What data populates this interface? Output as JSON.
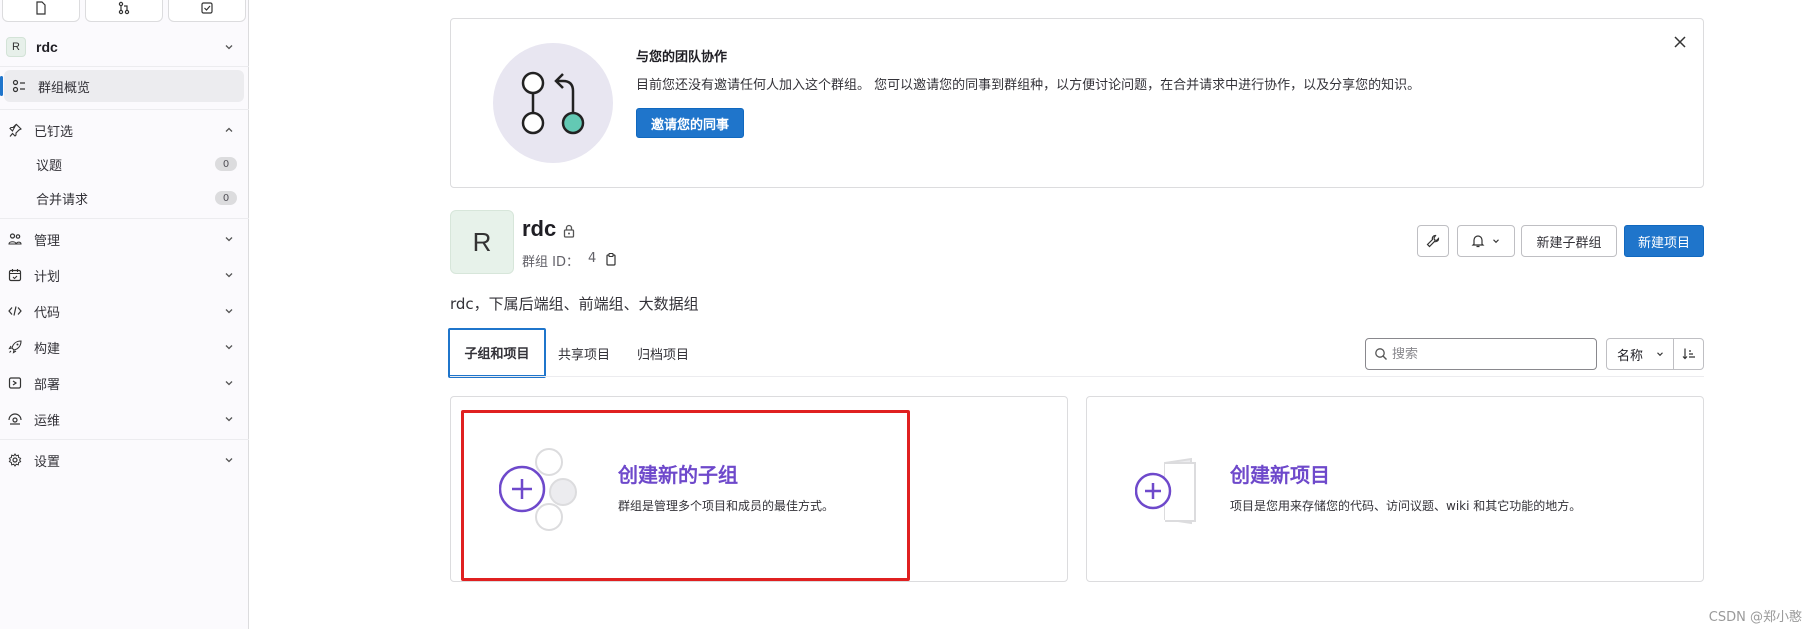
{
  "sidebar": {
    "top_buttons": [
      {
        "icon": "file-icon"
      },
      {
        "icon": "merge-request-icon"
      },
      {
        "icon": "todo-icon"
      }
    ],
    "group": {
      "avatar_letter": "R",
      "name": "rdc"
    },
    "overview_label": "群组概览",
    "pinned": {
      "label": "已钉选",
      "items": [
        {
          "label": "议题",
          "count": "0"
        },
        {
          "label": "合并请求",
          "count": "0"
        }
      ]
    },
    "sections": [
      {
        "label": "管理",
        "icon": "users-icon"
      },
      {
        "label": "计划",
        "icon": "calendar-icon"
      },
      {
        "label": "代码",
        "icon": "code-icon"
      },
      {
        "label": "构建",
        "icon": "rocket-icon"
      },
      {
        "label": "部署",
        "icon": "deploy-icon"
      },
      {
        "label": "运维",
        "icon": "monitor-icon"
      },
      {
        "label": "设置",
        "icon": "gear-icon"
      }
    ]
  },
  "banner": {
    "title": "与您的团队协作",
    "description": "目前您还没有邀请任何人加入这个群组。 您可以邀请您的同事到群组种，以方便讨论问题，在合并请求中进行协作，以及分享您的知识。",
    "button": "邀请您的同事"
  },
  "group": {
    "avatar_letter": "R",
    "name": "rdc",
    "id_label": "群组 ID：",
    "id_value": "4",
    "description": "rdc，下属后端组、前端组、大数据组",
    "new_subgroup_button": "新建子群组",
    "new_project_button": "新建项目"
  },
  "tabs": [
    {
      "label": "子组和项目",
      "active": true
    },
    {
      "label": "共享项目",
      "active": false
    },
    {
      "label": "归档项目",
      "active": false
    }
  ],
  "search": {
    "placeholder": "搜索"
  },
  "sort": {
    "label": "名称"
  },
  "cards": [
    {
      "title": "创建新的子组",
      "description": "群组是管理多个项目和成员的最佳方式。"
    },
    {
      "title": "创建新项目",
      "description": "项目是您用来存储您的代码、访问议题、wiki 和其它功能的地方。"
    }
  ],
  "watermark": "CSDN @郑小憨",
  "colors": {
    "primary": "#1f75cb",
    "accent_purple": "#6e49cb",
    "highlight_red": "#e02020"
  }
}
